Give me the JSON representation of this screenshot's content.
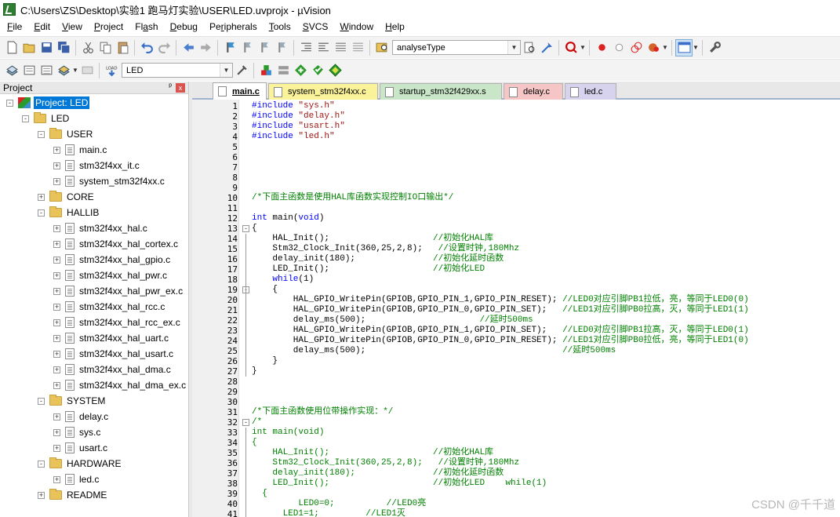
{
  "window": {
    "title": "C:\\Users\\ZS\\Desktop\\实验1 跑马灯实验\\USER\\LED.uvprojx - µVision"
  },
  "menu": [
    "File",
    "Edit",
    "View",
    "Project",
    "Flash",
    "Debug",
    "Peripherals",
    "Tools",
    "SVCS",
    "Window",
    "Help"
  ],
  "menu_underline": [
    "F",
    "E",
    "V",
    "P",
    "a",
    "D",
    "r",
    "T",
    "S",
    "W",
    "H"
  ],
  "toolbar1": {
    "find_combo": "analyseType"
  },
  "toolbar2": {
    "target_combo": "LED",
    "load_label": "LOAD"
  },
  "project_panel": {
    "title": "Project",
    "pin": "ᵖ",
    "close": "x",
    "root": "Project: LED",
    "target": "LED",
    "groups": [
      {
        "name": "USER",
        "files": [
          "main.c",
          "stm32f4xx_it.c",
          "system_stm32f4xx.c"
        ]
      },
      {
        "name": "CORE",
        "files": []
      },
      {
        "name": "HALLIB",
        "files": [
          "stm32f4xx_hal.c",
          "stm32f4xx_hal_cortex.c",
          "stm32f4xx_hal_gpio.c",
          "stm32f4xx_hal_pwr.c",
          "stm32f4xx_hal_pwr_ex.c",
          "stm32f4xx_hal_rcc.c",
          "stm32f4xx_hal_rcc_ex.c",
          "stm32f4xx_hal_uart.c",
          "stm32f4xx_hal_usart.c",
          "stm32f4xx_hal_dma.c",
          "stm32f4xx_hal_dma_ex.c"
        ]
      },
      {
        "name": "SYSTEM",
        "files": [
          "delay.c",
          "sys.c",
          "usart.c"
        ]
      },
      {
        "name": "HARDWARE",
        "files": [
          "led.c"
        ]
      },
      {
        "name": "README",
        "files": []
      }
    ]
  },
  "tabs": [
    {
      "label": "main.c",
      "color": "#ffffff",
      "active": true
    },
    {
      "label": "system_stm32f4xx.c",
      "color": "#fbf39a",
      "active": false
    },
    {
      "label": "startup_stm32f429xx.s",
      "color": "#c9e6c9",
      "active": false
    },
    {
      "label": "delay.c",
      "color": "#f6c6c6",
      "active": false
    },
    {
      "label": "led.c",
      "color": "#d7d2ee",
      "active": false
    }
  ],
  "code_lines": [
    [
      [
        "pp",
        "#include "
      ],
      [
        "str",
        "\"sys.h\""
      ]
    ],
    [
      [
        "pp",
        "#include "
      ],
      [
        "str",
        "\"delay.h\""
      ]
    ],
    [
      [
        "pp",
        "#include "
      ],
      [
        "str",
        "\"usart.h\""
      ]
    ],
    [
      [
        "pp",
        "#include "
      ],
      [
        "str",
        "\"led.h\""
      ]
    ],
    [],
    [],
    [],
    [],
    [],
    [
      [
        "cm",
        "/*下面主函数是使用HAL库函数实现控制IO口输出*/"
      ]
    ],
    [],
    [
      [
        "kw",
        "int"
      ],
      [
        "n",
        " main("
      ],
      [
        "kw",
        "void"
      ],
      [
        "n",
        ")"
      ]
    ],
    [
      [
        "n",
        "{"
      ]
    ],
    [
      [
        "n",
        "    HAL_Init();                    "
      ],
      [
        "cm",
        "//初始化HAL库"
      ]
    ],
    [
      [
        "n",
        "    Stm32_Clock_Init(360,25,2,8);   "
      ],
      [
        "cm",
        "//设置时钟,180Mhz"
      ]
    ],
    [
      [
        "n",
        "    delay_init(180);               "
      ],
      [
        "cm",
        "//初始化延时函数"
      ]
    ],
    [
      [
        "n",
        "    LED_Init();                    "
      ],
      [
        "cm",
        "//初始化LED"
      ]
    ],
    [
      [
        "n",
        "    "
      ],
      [
        "kw",
        "while"
      ],
      [
        "n",
        "(1)"
      ]
    ],
    [
      [
        "n",
        "    {"
      ]
    ],
    [
      [
        "n",
        "        HAL_GPIO_WritePin(GPIOB,GPIO_PIN_1,GPIO_PIN_RESET); "
      ],
      [
        "cm",
        "//LED0对应引脚PB1拉低，亮，等同于LED0(0)"
      ]
    ],
    [
      [
        "n",
        "        HAL_GPIO_WritePin(GPIOB,GPIO_PIN_0,GPIO_PIN_SET);   "
      ],
      [
        "cm",
        "//LED1对应引脚PB0拉高，灭，等同于LED1(1)"
      ]
    ],
    [
      [
        "n",
        "        delay_ms(500);                      "
      ],
      [
        "cm",
        "//延时500ms"
      ]
    ],
    [
      [
        "n",
        "        HAL_GPIO_WritePin(GPIOB,GPIO_PIN_1,GPIO_PIN_SET);   "
      ],
      [
        "cm",
        "//LED0对应引脚PB1拉高，灭，等同于LED0(1)"
      ]
    ],
    [
      [
        "n",
        "        HAL_GPIO_WritePin(GPIOB,GPIO_PIN_0,GPIO_PIN_RESET); "
      ],
      [
        "cm",
        "//LED1对应引脚PB0拉低，亮，等同于LED1(0)"
      ]
    ],
    [
      [
        "n",
        "        delay_ms(500);                                      "
      ],
      [
        "cm",
        "//延时500ms"
      ]
    ],
    [
      [
        "n",
        "    }"
      ]
    ],
    [
      [
        "n",
        "}"
      ]
    ],
    [],
    [],
    [],
    [
      [
        "cm",
        "/*下面主函数使用位带操作实现：*/"
      ]
    ],
    [
      [
        "cm",
        "/*"
      ]
    ],
    [
      [
        "cm",
        "int main(void)"
      ]
    ],
    [
      [
        "cm",
        "{"
      ]
    ],
    [
      [
        "cm",
        "    HAL_Init();                    //初始化HAL库"
      ]
    ],
    [
      [
        "cm",
        "    Stm32_Clock_Init(360,25,2,8);   //设置时钟,180Mhz"
      ]
    ],
    [
      [
        "cm",
        "    delay_init(180);               //初始化延时函数"
      ]
    ],
    [
      [
        "cm",
        "    LED_Init();                    //初始化LED    while(1)"
      ]
    ],
    [
      [
        "cm",
        "  {"
      ]
    ],
    [
      [
        "cm",
        "         LED0=0;          //LED0亮"
      ]
    ],
    [
      [
        "cm",
        "      LED1=1;         //LED1灭"
      ]
    ]
  ],
  "fold_markers": {
    "13": "-",
    "19": "-",
    "32": "-"
  },
  "watermark": "CSDN @千千道",
  "colors": {
    "keyword": "#0000ff",
    "string": "#a31515",
    "comment": "#008000",
    "selection": "#0078d7"
  }
}
